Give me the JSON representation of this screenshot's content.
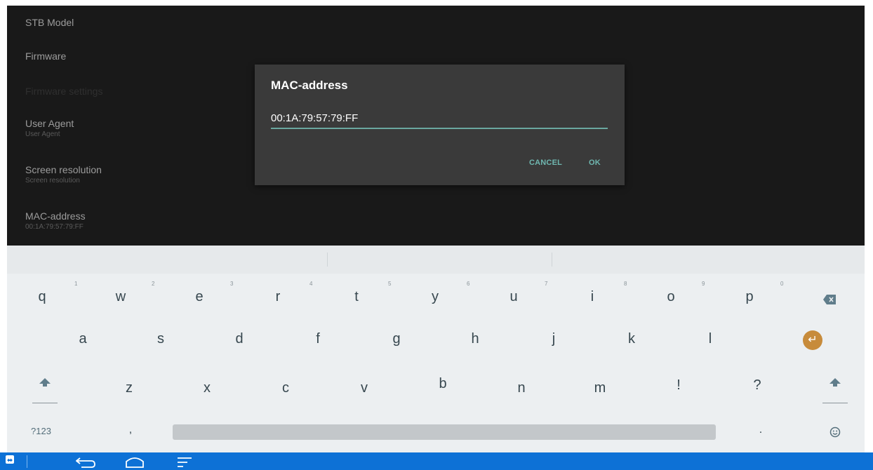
{
  "settings": {
    "items": [
      {
        "title": "STB Model",
        "sub": ""
      },
      {
        "title": "Firmware",
        "sub": ""
      },
      {
        "title": "Firmware settings",
        "sub": ""
      },
      {
        "title": "User Agent",
        "sub": "User Agent"
      },
      {
        "title": "Screen resolution",
        "sub": "Screen resolution"
      },
      {
        "title": "MAC-address",
        "sub": "00:1A:79:57:79:FF"
      }
    ]
  },
  "dialog": {
    "title": "MAC-address",
    "value": "00:1A:79:57:79:FF",
    "cancel_label": "CANCEL",
    "ok_label": "OK"
  },
  "keyboard": {
    "row1": [
      "q",
      "w",
      "e",
      "r",
      "t",
      "y",
      "u",
      "i",
      "o",
      "p"
    ],
    "row1_hints": [
      "1",
      "2",
      "3",
      "4",
      "5",
      "6",
      "7",
      "8",
      "9",
      "0"
    ],
    "row2": [
      "a",
      "s",
      "d",
      "f",
      "g",
      "h",
      "j",
      "k",
      "l"
    ],
    "row3": [
      "z",
      "x",
      "c",
      "v",
      "b",
      "n",
      "m",
      "!",
      "?"
    ],
    "symbols_label": "?123",
    "comma": ",",
    "period": ".",
    "icons": {
      "backspace": "backspace-icon",
      "enter": "enter-icon",
      "shift": "shift-icon",
      "emoji": "emoji-icon"
    },
    "colors": {
      "enter_accent": "#c78b3b",
      "field_underline": "#6aa7a0",
      "dialog_button": "#6fb7b0"
    }
  },
  "navbar": {
    "color": "#0d71d6",
    "icons": [
      "teamviewer-icon",
      "back-icon",
      "home-icon",
      "recent-apps-icon"
    ]
  }
}
